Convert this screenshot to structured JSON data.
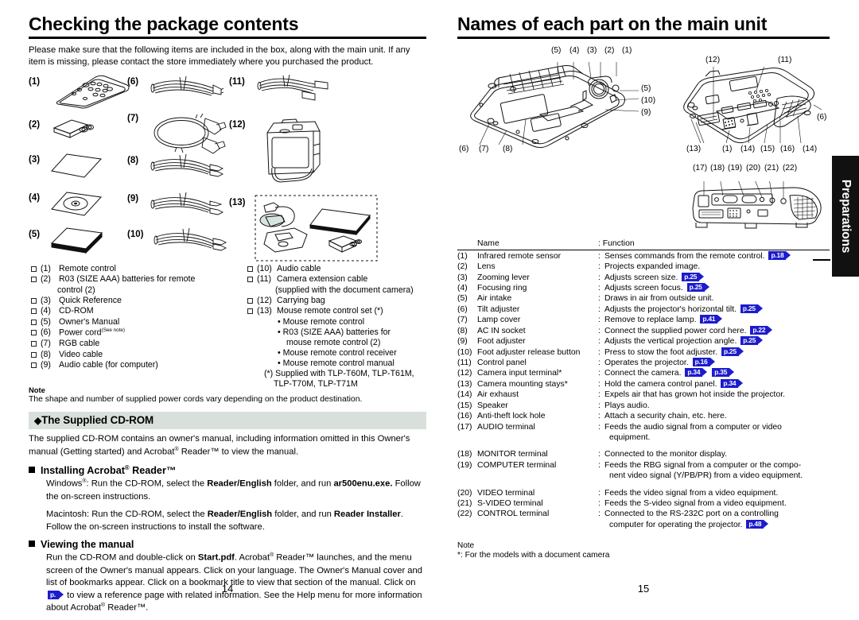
{
  "left_page": {
    "chapter_title": "Checking the package contents",
    "intro": "Please make sure that the following items are included in the box, along with the main unit. If any item is missing, please contact the store immediately where you purchased the product.",
    "illustration_numbers": [
      "(1)",
      "(2)",
      "(3)",
      "(4)",
      "(5)",
      "(6)",
      "(7)",
      "(8)",
      "(9)",
      "(10)",
      "(11)",
      "(12)",
      "(13)"
    ],
    "checklist_col_a": [
      {
        "num": "(1)",
        "text": "Remote control"
      },
      {
        "num": "(2)",
        "text": "R03 (SIZE AAA) batteries for remote"
      },
      {
        "num": "(3)",
        "text": "Quick Reference"
      },
      {
        "num": "(4)",
        "text": "CD-ROM"
      },
      {
        "num": "(5)",
        "text": "Owner's Manual"
      },
      {
        "num": "(6)",
        "text": "Power cord"
      },
      {
        "num": "(7)",
        "text": "RGB cable"
      },
      {
        "num": "(8)",
        "text": "Video cable"
      },
      {
        "num": "(9)",
        "text": "Audio cable (for computer)"
      }
    ],
    "checklist_a_cont_2": "control (2)",
    "power_cord_sup": "(See note)",
    "checklist_col_b": [
      {
        "num": "(10)",
        "text": "Audio cable"
      },
      {
        "num": "(11)",
        "text": "Camera extension cable"
      },
      {
        "num": "(12)",
        "text": "Carrying bag"
      },
      {
        "num": "(13)",
        "text": "Mouse remote control set (*)"
      }
    ],
    "checklist_b_cont_11": "(supplied with the document camera)",
    "mouse_set_bullets": [
      "• Mouse remote control",
      "• R03 (SIZE AAA) batteries for",
      "mouse remote control (2)",
      "• Mouse remote control receiver",
      "• Mouse remote control manual"
    ],
    "star_note_line1": "(*) Supplied with TLP-T60M, TLP-T61M,",
    "star_note_line2": "TLP-T70M, TLP-T71M",
    "note_label": "Note",
    "note_text": "The shape and number of supplied power cords vary depending on the product destination.",
    "section_bar": "The Supplied CD-ROM",
    "section_diamond": "◆",
    "cdrom_para_1": "The supplied CD-ROM contains an owner's manual, including information omitted in this",
    "cdrom_para_2a": "Owner's manual (Getting started) and Acrobat",
    "cdrom_para_2b": "Reader™ to view the manual.",
    "sub1_title_a": "Installing Acrobat",
    "sub1_title_b": "Reader™",
    "sub1_win_a": "Windows",
    "sub1_win_b": ": Run the CD-ROM, select the ",
    "sub1_win_bold1": "Reader/English",
    "sub1_win_c": " folder, and run ",
    "sub1_win_bold2": "ar500enu.exe.",
    "sub1_win_d": "Follow the on-screen instructions.",
    "sub1_mac_a": "Macintosh: Run the CD-ROM, select the ",
    "sub1_mac_bold1": "Reader/English",
    "sub1_mac_b": " folder, and run ",
    "sub1_mac_bold2": "Reader",
    "sub1_mac_bold3": "Installer",
    "sub1_mac_c": ". Follow the on-screen instructions to install the software.",
    "sub2_title": "Viewing the manual",
    "sub2_a": "Run the CD-ROM and double-click on ",
    "sub2_bold": "Start.pdf",
    "sub2_b": ". Acrobat",
    "sub2_c": " Reader™ launches, and the menu screen of the Owner's manual appears. Click on your language. The Owner's Manual cover and list of bookmarks appear. Click on a bookmark title to view that section of the manual. Click on ",
    "sub2_badge": "p.",
    "sub2_d": " to view a reference page with related information. See the Help menu for more information about Acrobat",
    "sub2_e": " Reader™.",
    "page_number": "14"
  },
  "right_page": {
    "chapter_title": "Names of each part on the main unit",
    "diagram_top_left_callouts": [
      "(5)",
      "(4)",
      "(3)",
      "(2)",
      "(1)",
      "(5)",
      "(10)",
      "(9)",
      "(6)",
      "(7)",
      "(8)"
    ],
    "diagram_top_right_callouts": [
      "(12)",
      "(11)",
      "(6)",
      "(13)",
      "(1)",
      "(14)",
      "(15)",
      "(16)",
      "(14)"
    ],
    "diagram_bottom_callouts": [
      "(17)",
      "(18)",
      "(19)",
      "(20)",
      "(21)",
      "(22)"
    ],
    "table_header": {
      "name": "Name",
      "function": ": Function"
    },
    "rows": [
      {
        "num": "(1)",
        "name": "Infrared remote sensor",
        "fn": "Senses commands from the remote control.",
        "refs": [
          "p.18"
        ]
      },
      {
        "num": "(2)",
        "name": "Lens",
        "fn": "Projects expanded image.",
        "refs": []
      },
      {
        "num": "(3)",
        "name": "Zooming lever",
        "fn": "Adjusts screen size.",
        "refs": [
          "p.25"
        ]
      },
      {
        "num": "(4)",
        "name": "Focusing ring",
        "fn": "Adjusts screen focus.",
        "refs": [
          "p.25"
        ]
      },
      {
        "num": "(5)",
        "name": "Air intake",
        "fn": "Draws in air from outside unit.",
        "refs": []
      },
      {
        "num": "(6)",
        "name": "Tilt adjuster",
        "fn": "Adjusts the projector's horizontal tilt.",
        "refs": [
          "p.25"
        ]
      },
      {
        "num": "(7)",
        "name": "Lamp cover",
        "fn": "Remove to replace lamp.",
        "refs": [
          "p.41"
        ]
      },
      {
        "num": "(8)",
        "name": "AC IN socket",
        "fn": "Connect the supplied power cord here.",
        "refs": [
          "p.22"
        ]
      },
      {
        "num": "(9)",
        "name": "Foot adjuster",
        "fn": "Adjusts the vertical projection angle.",
        "refs": [
          "p.25"
        ]
      },
      {
        "num": "(10)",
        "name": "Foot adjuster release button",
        "fn": "Press to stow the foot adjuster.",
        "refs": [
          "p.25"
        ]
      },
      {
        "num": "(11)",
        "name": "Control panel",
        "fn": "Operates the projector.",
        "refs": [
          "p.16"
        ]
      },
      {
        "num": "(12)",
        "name": "Camera input terminal*",
        "fn": "Connect the camera.",
        "refs": [
          "p.34",
          "p.35"
        ]
      },
      {
        "num": "(13)",
        "name": "Camera mounting stays*",
        "fn": "Hold the camera control panel.",
        "refs": [
          "p.34"
        ]
      },
      {
        "num": "(14)",
        "name": "Air exhaust",
        "fn": "Expels air that has grown hot inside the projector.",
        "refs": []
      },
      {
        "num": "(15)",
        "name": "Speaker",
        "fn": "Plays audio.",
        "refs": []
      },
      {
        "num": "(16)",
        "name": "Anti-theft lock hole",
        "fn": "Attach a security chain, etc. here.",
        "refs": []
      },
      {
        "num": "(17)",
        "name": "AUDIO terminal",
        "fn": "Feeds the audio signal from a computer or video",
        "cont": "equipment.",
        "refs": []
      },
      {
        "num": "(18)",
        "name": "MONITOR terminal",
        "fn": "Connected to the monitor display.",
        "refs": []
      },
      {
        "num": "(19)",
        "name": "COMPUTER terminal",
        "fn": "Feeds the RBG signal from a computer or the compo-",
        "cont": "nent video signal (Y/PB/PR) from a video equipment.",
        "refs": []
      },
      {
        "num": "(20)",
        "name": "VIDEO terminal",
        "fn": "Feeds the video signal from a video equipment.",
        "refs": []
      },
      {
        "num": "(21)",
        "name": "S-VIDEO terminal",
        "fn": "Feeds the S-video signal from a video equipment.",
        "refs": []
      },
      {
        "num": "(22)",
        "name": "CONTROL terminal",
        "fn": "Connected to the RS-232C port on a controlling",
        "cont": "computer for operating the projector.",
        "cont_refs": [
          "p.48"
        ],
        "refs": []
      }
    ],
    "note_label": "Note",
    "note_text": "*: For the models with a document camera",
    "page_number": "15",
    "side_tab": "Preparations"
  },
  "colors": {
    "page_ref_badge": "#1c1ccc",
    "section_bar": "#d9e0dc",
    "side_tab": "#111111"
  }
}
